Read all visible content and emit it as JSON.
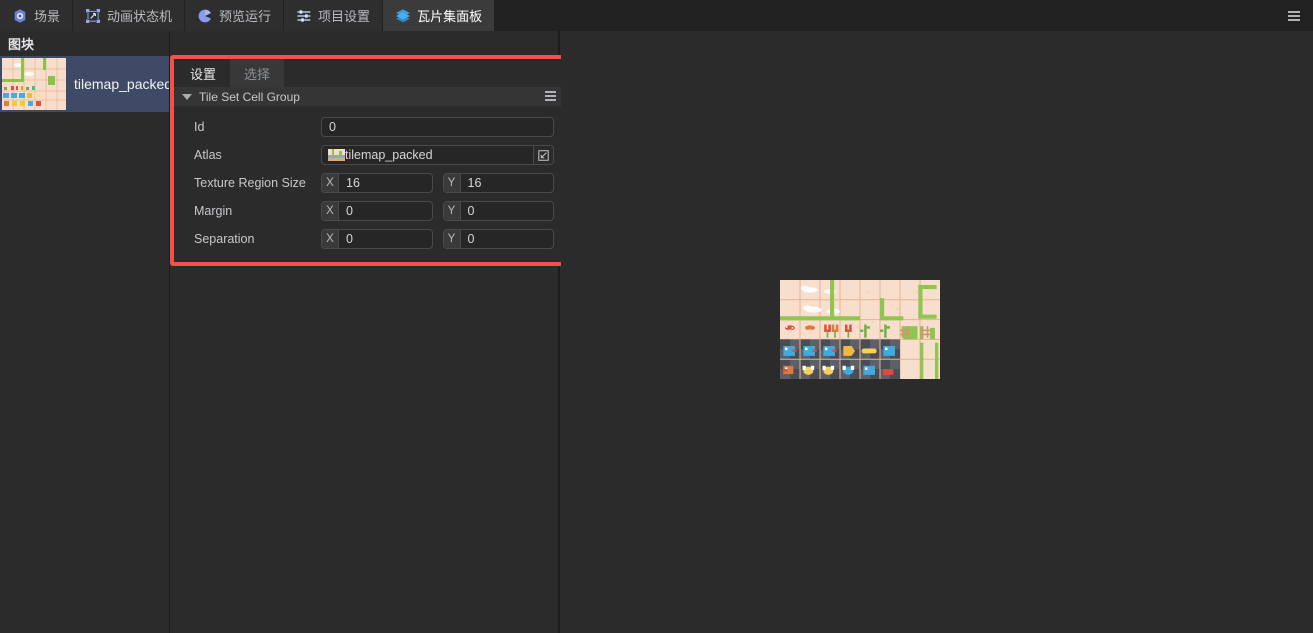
{
  "window": {
    "menu_icon": "hamburger-icon"
  },
  "topbar": {
    "tabs": [
      {
        "label": "场景",
        "icon": "scene-icon",
        "active": false
      },
      {
        "label": "动画状态机",
        "icon": "animation-state-machine-icon",
        "active": false
      },
      {
        "label": "预览运行",
        "icon": "preview-run-icon",
        "active": false
      },
      {
        "label": "项目设置",
        "icon": "project-settings-icon",
        "active": false
      },
      {
        "label": "瓦片集面板",
        "icon": "tileset-panel-icon",
        "active": true
      }
    ]
  },
  "left_panel": {
    "header": "图块",
    "items": [
      {
        "label": "tilemap_packed",
        "thumbnail": "tilemap-thumbnail",
        "selected": true
      }
    ]
  },
  "inspector": {
    "tabs": [
      {
        "label": "设置",
        "active": true
      },
      {
        "label": "选择",
        "active": false
      }
    ],
    "group": {
      "title": "Tile Set Cell Group",
      "collapsed": false,
      "menu_icon": "group-menu-icon"
    },
    "properties": [
      {
        "label": "Id",
        "type": "single",
        "value": "0"
      },
      {
        "label": "Atlas",
        "type": "resource",
        "value": "tilemap_packed",
        "thumbnail": "atlas-thumbnail",
        "expand_icon": "open-in-new-icon"
      },
      {
        "label": "Texture Region Size",
        "type": "vector2",
        "x_axis": "X",
        "x": "16",
        "y_axis": "Y",
        "y": "16"
      },
      {
        "label": "Margin",
        "type": "vector2",
        "x_axis": "X",
        "x": "0",
        "y_axis": "Y",
        "y": "0"
      },
      {
        "label": "Separation",
        "type": "vector2",
        "x_axis": "X",
        "x": "0",
        "y_axis": "Y",
        "y": "0"
      }
    ],
    "highlight_color": "#f05248"
  },
  "viewport": {
    "atlas_image": "tilemap_packed-atlas",
    "background_color": "#2b2b2b"
  },
  "colors": {
    "app_bg": "#2b2b2b",
    "topbar_bg": "#212121",
    "tab_active_bg": "#3b3b3b",
    "selection_bg": "#3e4a66",
    "accent_blue": "#3b9fdd",
    "highlight_red": "#f05248"
  }
}
